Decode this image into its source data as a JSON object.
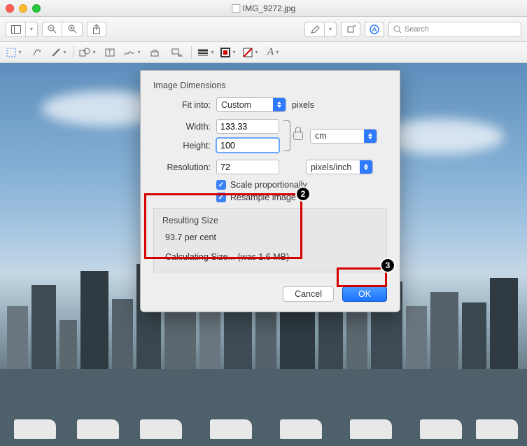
{
  "window": {
    "title": "IMG_9272.jpg"
  },
  "toolbar": {
    "search_placeholder": "Search"
  },
  "dialog": {
    "section_title": "Image Dimensions",
    "fit_into_label": "Fit into:",
    "fit_into_value": "Custom",
    "fit_into_unit": "pixels",
    "width_label": "Width:",
    "width_value": "133.33",
    "height_label": "Height:",
    "height_value": "100",
    "dim_unit": "cm",
    "resolution_label": "Resolution:",
    "resolution_value": "72",
    "resolution_unit": "pixels/inch",
    "scale_prop_label": "Scale proportionally",
    "resample_label": "Resample image",
    "resulting_title": "Resulting Size",
    "resulting_percent": "93.7 per cent",
    "resulting_calc": "Calculating Size... (was 1.6 MB)",
    "cancel_label": "Cancel",
    "ok_label": "OK"
  },
  "badges": {
    "b2": "2",
    "b3": "3"
  }
}
